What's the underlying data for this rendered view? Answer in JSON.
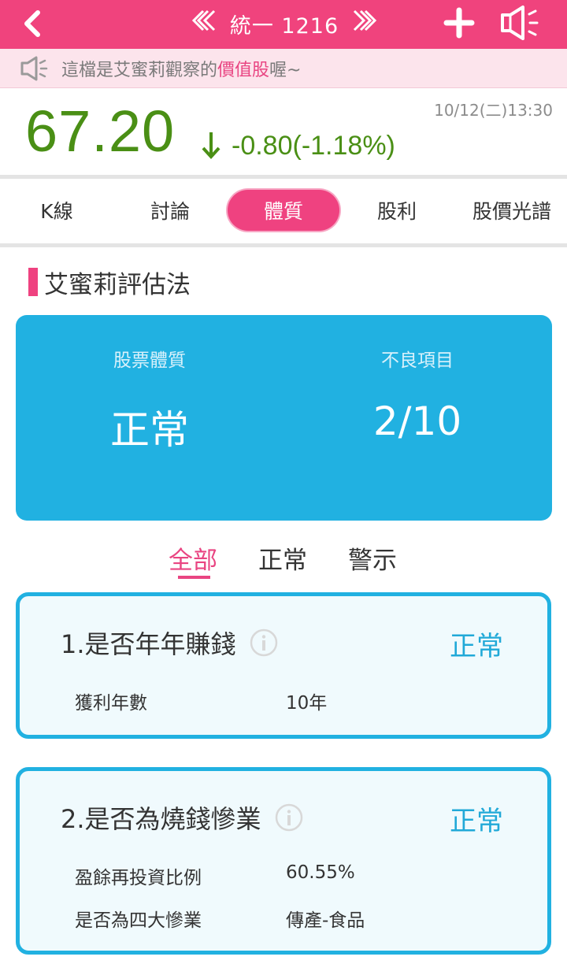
{
  "header": {
    "stock_title": "統一 1216",
    "prev_label": "《《",
    "next_label": "》》"
  },
  "notice": {
    "text_before": "這檔是艾蜜莉觀察的",
    "highlight": "價值股",
    "text_after": "喔~"
  },
  "quote": {
    "price": "67.20",
    "change": "-0.80(-1.18%)",
    "timestamp": "10/12(二)13:30",
    "color": "#4a8f15"
  },
  "tabs": [
    {
      "label": "K線"
    },
    {
      "label": "討論"
    },
    {
      "label": "體質",
      "active": true
    },
    {
      "label": "股利"
    },
    {
      "label": "股價光譜"
    }
  ],
  "section": {
    "title": "艾蜜莉評估法"
  },
  "summary": {
    "quality_label": "股票體質",
    "quality_value": "正常",
    "bad_label": "不良項目",
    "bad_value": "2/10"
  },
  "filters": [
    {
      "label": "全部",
      "active": true
    },
    {
      "label": "正常"
    },
    {
      "label": "警示"
    }
  ],
  "items": [
    {
      "title": "1.是否年年賺錢",
      "status": "正常",
      "rows": [
        {
          "label": "獲利年數",
          "value": "10年"
        }
      ]
    },
    {
      "title": "2.是否為燒錢慘業",
      "status": "正常",
      "rows": [
        {
          "label": "盈餘再投資比例",
          "value": "60.55%"
        },
        {
          "label": "是否為四大慘業",
          "value": "傳產-食品"
        }
      ]
    }
  ],
  "colors": {
    "brand_pink": "#f0437d",
    "accent_blue": "#21b1e1",
    "price_green": "#4a8f15"
  }
}
